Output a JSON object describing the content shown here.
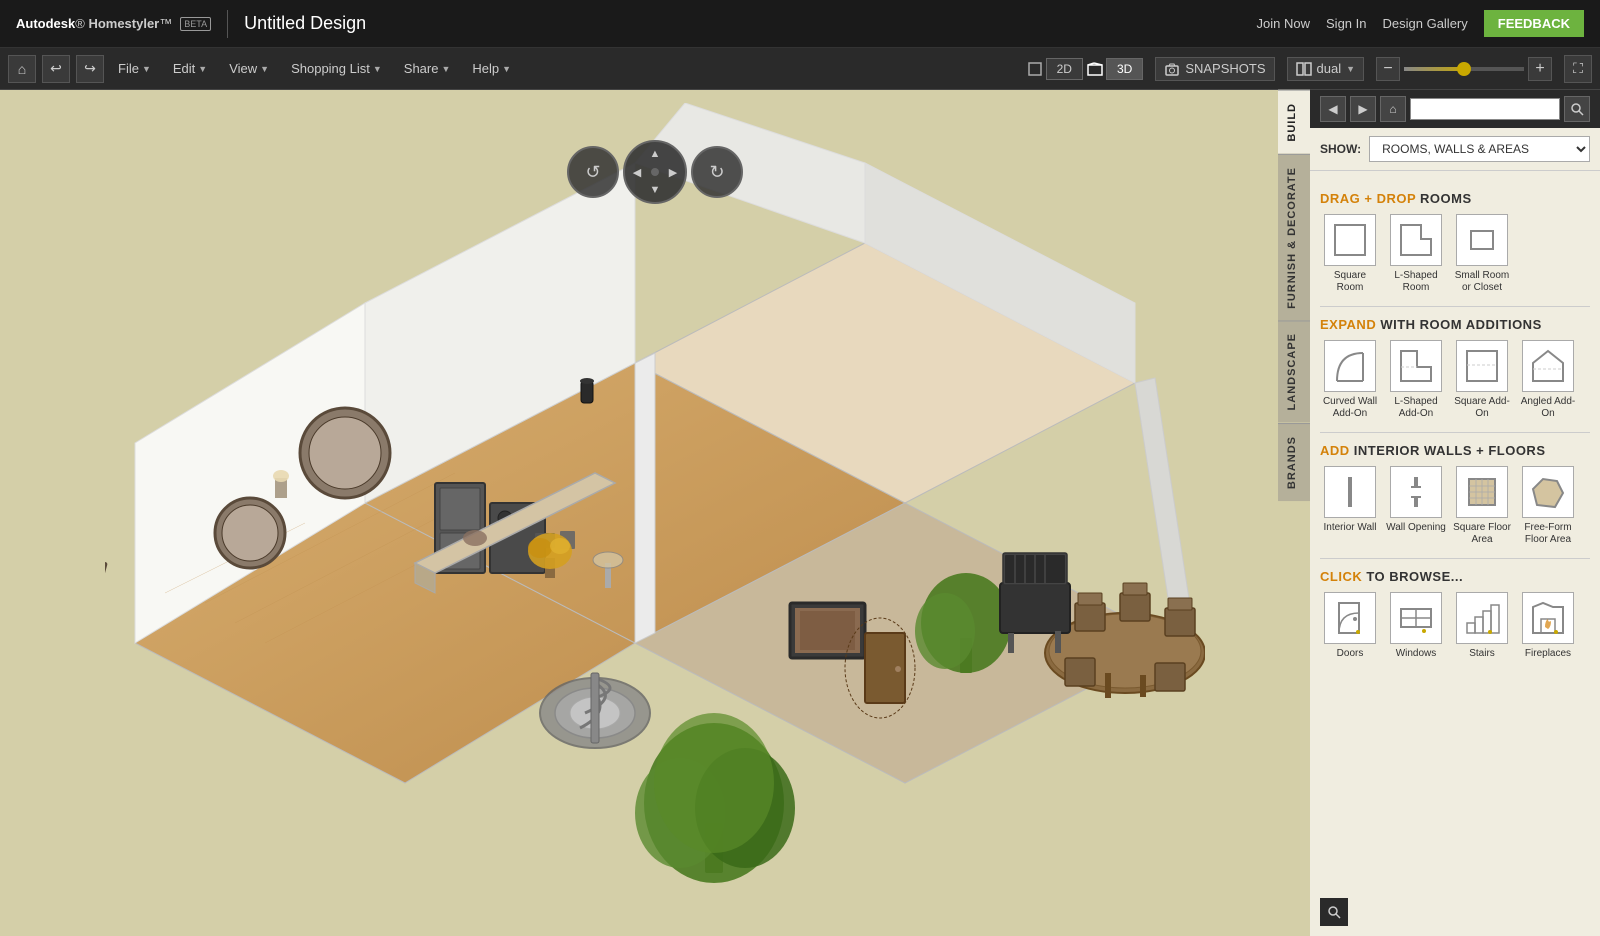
{
  "app": {
    "title": "Autodesk Homestyler",
    "beta_label": "BETA",
    "design_title": "Untitled Design"
  },
  "top_actions": {
    "join_now": "Join Now",
    "sign_in": "Sign In",
    "design_gallery": "Design Gallery",
    "feedback": "FEEDBACK"
  },
  "toolbar": {
    "undo": "↩",
    "redo": "↪",
    "file": "File",
    "edit": "Edit",
    "view": "View",
    "shopping_list": "Shopping List",
    "share": "Share",
    "help": "Help",
    "view_2d": "2D",
    "view_3d": "3D",
    "snapshots": "SNAPSHOTS",
    "dual": "dual"
  },
  "right_panel": {
    "show_label": "SHOW:",
    "show_option": "ROOMS, WALLS & AREAS",
    "build_tab": "BUILD",
    "furnish_tab": "FURNISH & DECORATE",
    "landscape_tab": "LANDSCAPE",
    "brands_tab": "BRANDS",
    "sections": {
      "drag_drop_rooms": {
        "prefix": "DRAG + DROP",
        "suffix": "ROOMS",
        "items": [
          {
            "label": "Square Room",
            "shape": "square"
          },
          {
            "label": "L-Shaped Room",
            "shape": "l-shape"
          },
          {
            "label": "Small Room or Closet",
            "shape": "small-square"
          }
        ]
      },
      "expand_rooms": {
        "prefix": "EXPAND",
        "suffix": "WITH ROOM ADDITIONS",
        "items": [
          {
            "label": "Curved Wall Add-On",
            "shape": "curved"
          },
          {
            "label": "L-Shaped Add-On",
            "shape": "l-addon"
          },
          {
            "label": "Square Add-On",
            "shape": "square-addon"
          },
          {
            "label": "Angled Add-On",
            "shape": "angled"
          }
        ]
      },
      "interior_walls": {
        "prefix": "ADD",
        "suffix": "INTERIOR WALLS + FLOORS",
        "items": [
          {
            "label": "Interior Wall",
            "shape": "int-wall"
          },
          {
            "label": "Wall Opening",
            "shape": "wall-opening"
          },
          {
            "label": "Square Floor Area",
            "shape": "sq-floor"
          },
          {
            "label": "Free-Form Floor Area",
            "shape": "ff-floor"
          }
        ]
      },
      "browse": {
        "prefix": "CLICK",
        "suffix": "TO BROWSE...",
        "items": [
          {
            "label": "Doors",
            "shape": "door"
          },
          {
            "label": "Windows",
            "shape": "window"
          },
          {
            "label": "Stairs",
            "shape": "stairs"
          },
          {
            "label": "Fireplaces",
            "shape": "fireplace"
          }
        ]
      }
    }
  }
}
